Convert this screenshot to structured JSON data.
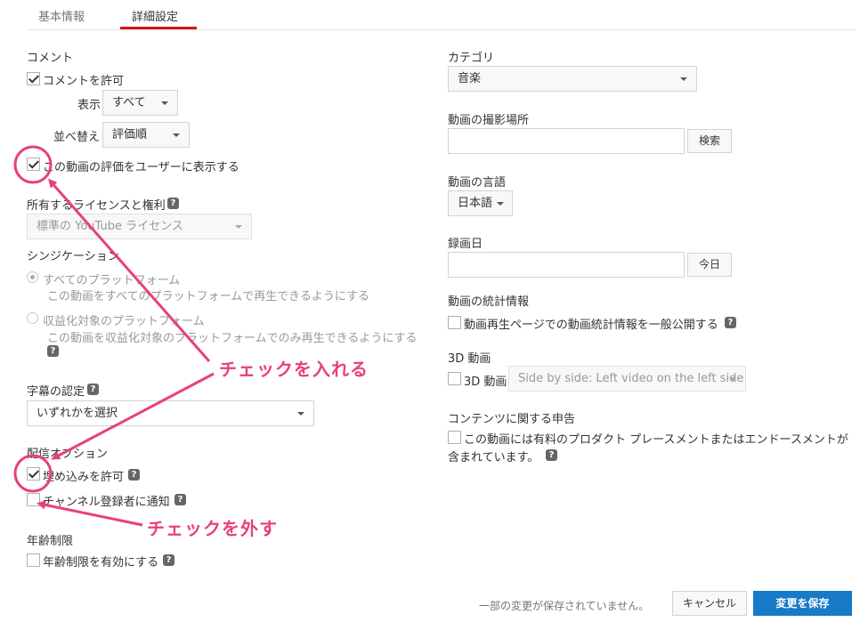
{
  "tabs": [
    {
      "label": "基本情報"
    },
    {
      "label": "詳細設定"
    }
  ],
  "left": {
    "comments": {
      "heading": "コメント",
      "allow_label": "コメントを許可",
      "allow_checked": true,
      "display_label": "表示",
      "display_value": "すべて",
      "sort_label": "並べ替え",
      "sort_value": "評価順",
      "show_ratings_label": "この動画の評価をユーザーに表示する",
      "show_ratings_checked": true
    },
    "license": {
      "heading": "所有するライセンスと権利",
      "value": "標準の YouTube ライセンス"
    },
    "syndication": {
      "heading": "シンジケーション",
      "option1_title": "すべてのプラットフォーム",
      "option1_desc": "この動画をすべてのプラットフォームで再生できるようにする",
      "option2_title": "収益化対象のプラットフォーム",
      "option2_desc": "この動画を収益化対象のプラットフォームでのみ再生できるようにする"
    },
    "captions": {
      "heading": "字幕の認定",
      "value": "いずれかを選択"
    },
    "distribution": {
      "heading": "配信オプション",
      "embed_label": "埋め込みを許可",
      "embed_checked": true,
      "notify_label": "チャンネル登録者に通知",
      "notify_checked": false
    },
    "age": {
      "heading": "年齢制限",
      "enable_label": "年齢制限を有効にする",
      "enable_checked": false
    }
  },
  "right": {
    "category": {
      "heading": "カテゴリ",
      "value": "音楽"
    },
    "location": {
      "heading": "動画の撮影場所",
      "search_button": "検索"
    },
    "language": {
      "heading": "動画の言語",
      "value": "日本語"
    },
    "recording_date": {
      "heading": "録画日",
      "today_button": "今日"
    },
    "stats": {
      "heading": "動画の統計情報",
      "label": "動画再生ページでの動画統計情報を一般公開する"
    },
    "three_d": {
      "heading": "3D 動画",
      "label": "3D 動画",
      "value": "Side by side: Left video on the left side"
    },
    "content": {
      "heading": "コンテンツに関する申告",
      "label_line1": "この動画には有料のプロダクト プレースメントまたはエンドースメントが",
      "label_line2": "含まれています。"
    }
  },
  "footer": {
    "unsaved": "一部の変更が保存されていません。",
    "cancel": "キャンセル",
    "save": "変更を保存"
  },
  "annotations": {
    "check_in": "チェックを入れる",
    "check_out": "チェックを外す",
    "color": "#e8407a"
  },
  "icons": {
    "help": "?"
  },
  "colors": {
    "accent_red": "#cc181e",
    "primary_blue": "#167ac6"
  }
}
